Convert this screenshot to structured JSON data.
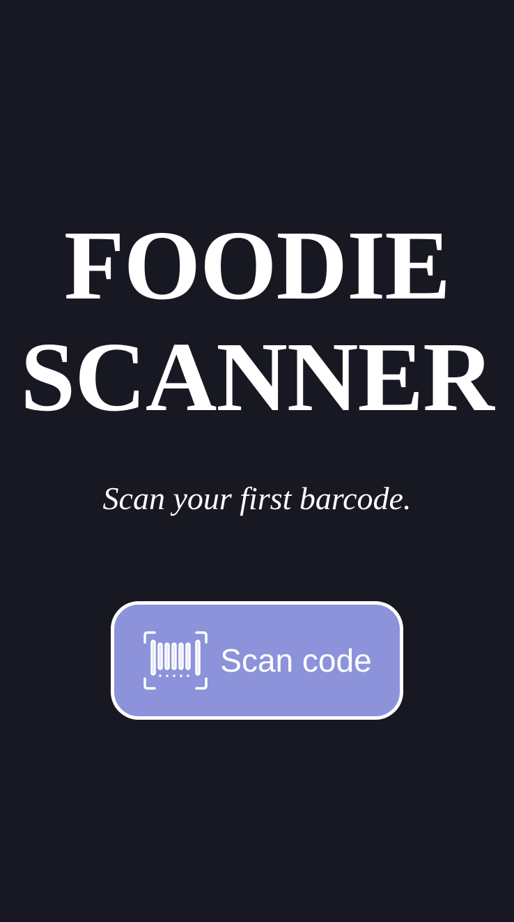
{
  "app": {
    "title_line_1": "FOODIE",
    "title_line_2": "SCANNER",
    "subtitle": "Scan your first barcode."
  },
  "scan_button": {
    "label": "Scan code",
    "icon": "barcode-scan-icon"
  },
  "colors": {
    "background": "#171822",
    "button_fill": "#8c93da",
    "button_border": "#ffffff",
    "text": "#ffffff"
  }
}
